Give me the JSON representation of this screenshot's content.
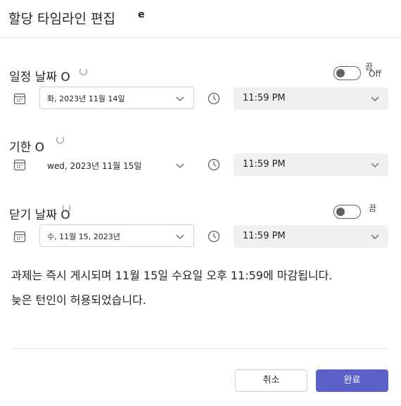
{
  "dialog": {
    "title": "할당 타임라인 편집",
    "title_suffix": "e"
  },
  "schedule": {
    "label": "일정 날짜 O",
    "toggle_on_label": "끔",
    "toggle_off_label": "Off",
    "date_value": "화, 2023년 11월 14일",
    "time_value": "11:59 PM"
  },
  "due": {
    "label": "기한 O",
    "date_value": "wed, 2023년 11월 15일",
    "time_value": "11:59 PM"
  },
  "close": {
    "label": "닫기 날짜 O",
    "toggle_label": "끔",
    "date_value": "수, 11월 15, 2023년",
    "time_value": "11:59 PM"
  },
  "info": {
    "line1": "과제는 즉시 게시되며 11월 15일 수요일 오후 11:59에 마감됩니다.",
    "line2": "늦은 턴인이 허용되었습니다."
  },
  "buttons": {
    "cancel": "취소",
    "done": "완료"
  }
}
